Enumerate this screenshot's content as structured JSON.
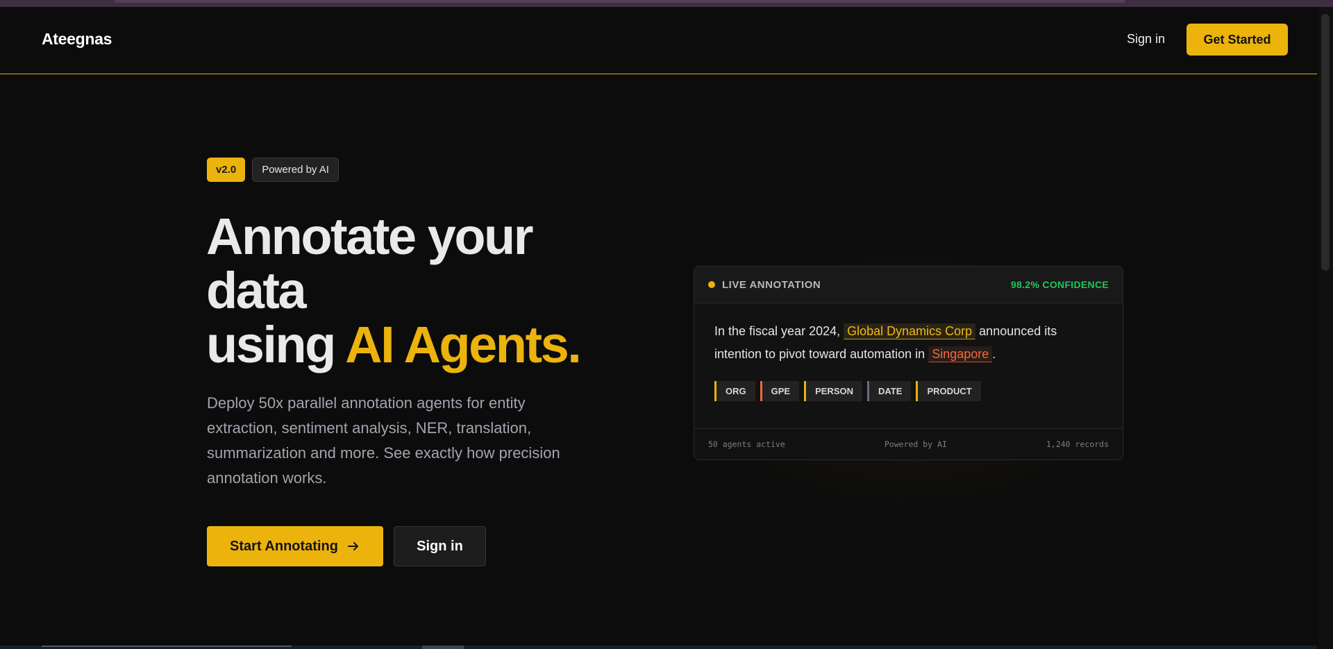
{
  "navbar": {
    "brand": "Ateegnas",
    "signin_label": "Sign in",
    "cta_label": "Get Started"
  },
  "hero": {
    "version_badge": "v2.0",
    "powered_badge": "Powered by AI",
    "title_line1": "Annotate your",
    "title_line2": "data",
    "title_line3_prefix": "using ",
    "title_line3_accent": "AI Agents.",
    "subtitle": "Deploy 50x parallel annotation agents for entity extraction, sentiment analysis, NER, translation, summarization and more. See exactly how precision annotation works.",
    "primary_button": "Start Annotating",
    "secondary_button": "Sign in"
  },
  "annotation_card": {
    "status_label": "LIVE ANNOTATION",
    "confidence": "98.2% CONFIDENCE",
    "sentence": {
      "part1": "In the fiscal year 2024, ",
      "entity_org": "Global Dynamics Corp",
      "part2": " announced its intention to pivot toward automation in ",
      "entity_gpe": "Singapore",
      "part3": "."
    },
    "tags": [
      "ORG",
      "GPE",
      "PERSON",
      "DATE",
      "PRODUCT"
    ],
    "footer": {
      "agents": "50 agents active",
      "powered": "Powered by AI",
      "records": "1,240 records"
    }
  },
  "colors": {
    "accent": "#ecb30c",
    "background": "#0c0c0c",
    "confidence_green": "#22c55e",
    "org_entity": "#f2b815",
    "gpe_entity": "#f26a3c"
  },
  "icons": {
    "primary_button_icon": "arrow-right-icon",
    "status_icon": "live-dot-icon"
  }
}
